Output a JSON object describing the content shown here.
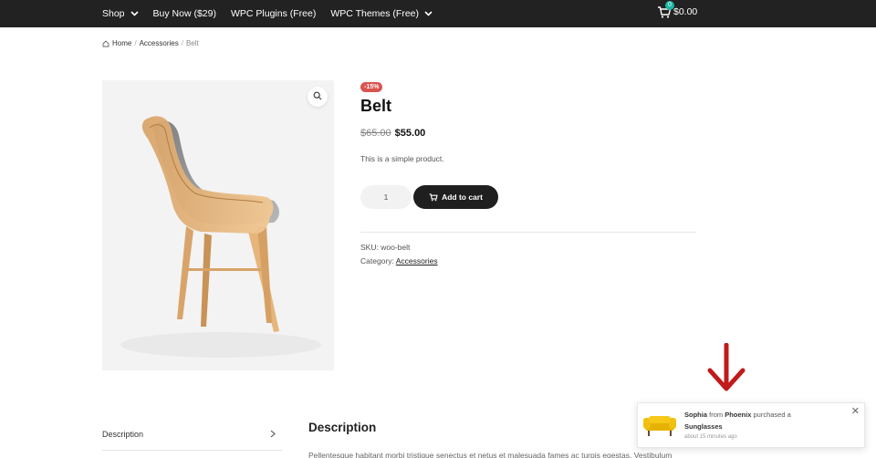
{
  "nav": {
    "items": [
      {
        "label": "Shop",
        "has_dropdown": true
      },
      {
        "label": "Buy Now ($29)",
        "has_dropdown": false
      },
      {
        "label": "WPC Plugins (Free)",
        "has_dropdown": false
      },
      {
        "label": "WPC Themes (Free)",
        "has_dropdown": true
      }
    ],
    "cart": {
      "count": "0",
      "total": "$0.00"
    }
  },
  "breadcrumb": {
    "home": "Home",
    "category": "Accessories",
    "current": "Belt"
  },
  "product": {
    "sale_badge": "-15%",
    "title": "Belt",
    "old_price": "$65.00",
    "new_price": "$55.00",
    "short_description": "This is a simple product.",
    "quantity": "1",
    "add_to_cart_label": "Add to cart",
    "sku_label": "SKU:",
    "sku": "woo-belt",
    "category_label": "Category:",
    "category": "Accessories"
  },
  "tabs": {
    "description_tab": "Description"
  },
  "description": {
    "heading": "Description",
    "body": "Pellentesque habitant morbi tristique senectus et netus et malesuada fames ac turpis egestas. Vestibulum"
  },
  "popup": {
    "customer": "Sophia",
    "from_word": "from",
    "city": "Phoenix",
    "action": "purchased a",
    "product": "Sunglasses",
    "time": "about 15 minutes ago"
  },
  "colors": {
    "topbar": "#222222",
    "sale_badge": "#d9534f",
    "cart_badge": "#1bb7a6",
    "button": "#1f1f1f",
    "arrow": "#c01a1a"
  },
  "icons": [
    "chevron-down-icon",
    "cart-icon",
    "home-icon",
    "magnify-icon",
    "chevron-right-icon",
    "close-icon",
    "down-arrow-icon"
  ]
}
